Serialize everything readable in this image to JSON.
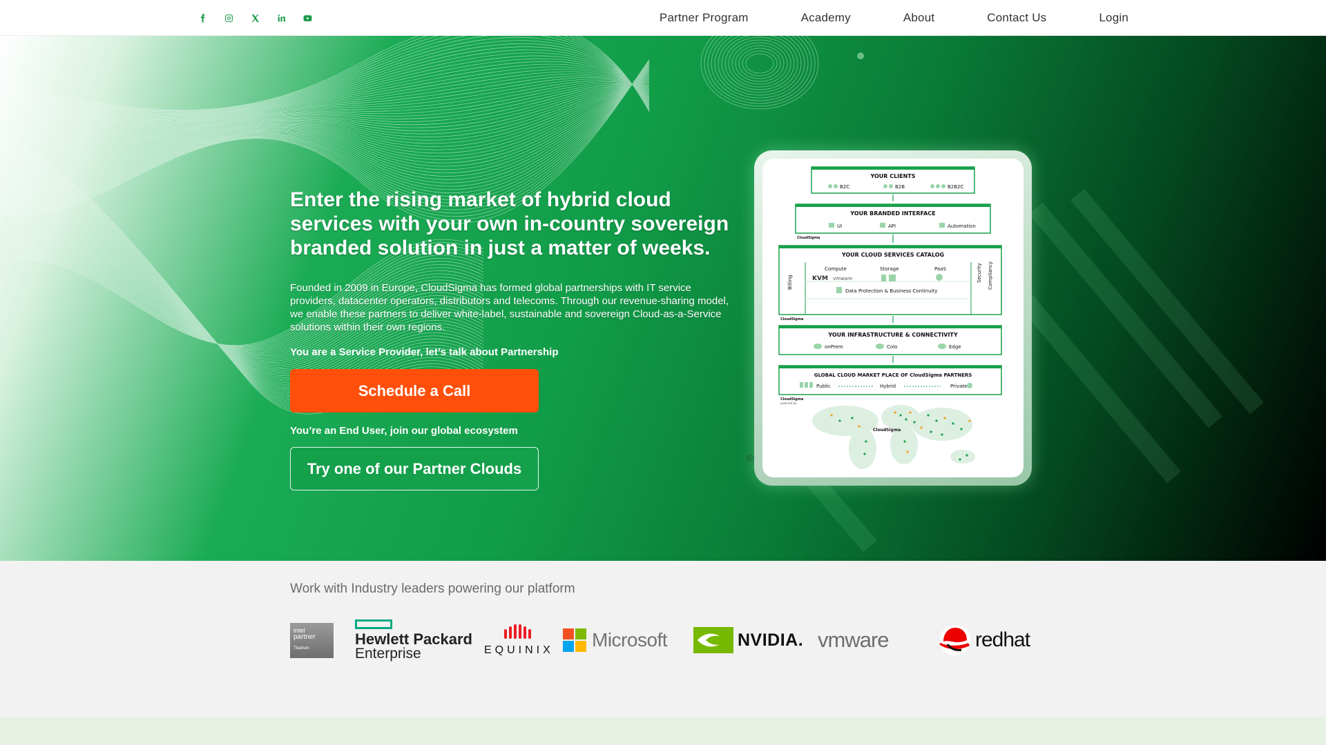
{
  "header": {
    "social": [
      {
        "name": "facebook-icon"
      },
      {
        "name": "instagram-icon"
      },
      {
        "name": "x-icon"
      },
      {
        "name": "linkedin-icon"
      },
      {
        "name": "youtube-icon"
      }
    ],
    "nav": [
      "Partner Program",
      "Academy",
      "About",
      "Contact Us",
      "Login"
    ]
  },
  "hero": {
    "headline": "Enter the rising market of hybrid cloud services with your own in-country sovereign branded solution in just a matter of weeks.",
    "intro": "Founded in 2009 in Europe, CloudSigma has formed global partnerships with IT service providers, datacenter operators, distributors and telecoms. Through our revenue-sharing model, we enable these partners to deliver white-label, sustainable and sovereign Cloud-as-a-Service solutions within their own regions.",
    "service_provider_label": "You are a Service Provider, let’s talk about Partnership",
    "schedule_button": "Schedule a Call",
    "end_user_label": "You’re an End User, join our global ecosystem",
    "partner_button": "Try one of our Partner Clouds",
    "colors": {
      "cta_orange": "#ff4f0a",
      "brand_green": "#15a04c"
    }
  },
  "diagram": {
    "clients_title": "YOUR CLIENTS",
    "clients": [
      "B2C",
      "B2B",
      "B2B2C"
    ],
    "interface_title": "YOUR BRANDED INTERFACE",
    "interface_items": [
      "UI",
      "API",
      "Automation"
    ],
    "catalog_title": "YOUR CLOUD SERVICES CATALOG",
    "billing": "Billing",
    "security": "Security",
    "compliancy": "Compliancy",
    "catalog_items": [
      "Compute",
      "Storage",
      "PaaS"
    ],
    "kvm": "KVM",
    "vmware": "vmware",
    "data_protection": "Data Protection & Business Continuity",
    "infra_title": "YOUR INFRASTRUCTURE & CONNECTIVITY",
    "infra_items": [
      "onPrem",
      "Colo",
      "Edge"
    ],
    "market_title": "GLOBAL CLOUD MARKET PLACE OF CloudSigma PARTNERS",
    "market_items": [
      "Public",
      "Hybrid",
      "Private"
    ],
    "brand": "CloudSigma",
    "powered_by": "powered by"
  },
  "partners": {
    "title": "Work with Industry leaders powering our platform",
    "intel": {
      "line1": "intel",
      "line2": "partner",
      "line3": "Titanium"
    },
    "hpe": {
      "line1": "Hewlett Packard",
      "line2": "Enterprise"
    },
    "equinix": "EQUINIX",
    "microsoft": "Microsoft",
    "nvidia": "NVIDIA.",
    "vmware": "vmware",
    "redhat": "redhat"
  }
}
